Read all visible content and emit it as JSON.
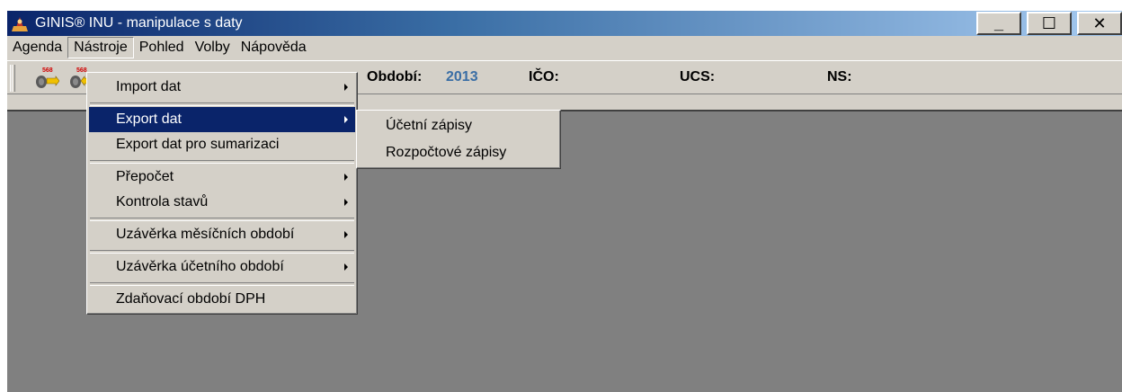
{
  "window": {
    "title": "GINIS® INU - manipulace s daty",
    "controls": {
      "minimize": "_",
      "maximize": "☐",
      "close": "✕"
    }
  },
  "menubar": [
    "Agenda",
    "Nástroje",
    "Pohled",
    "Volby",
    "Nápověda"
  ],
  "toolbar": {
    "icons": [
      "transfer-in-icon",
      "transfer-out-icon"
    ],
    "icon_label": "568",
    "obdobi_label": "Období:",
    "obdobi_value": "2013",
    "ico_label": "IČO:",
    "ucs_label": "UCS:",
    "ns_label": "NS:"
  },
  "nastroje_menu": {
    "import": "Import dat",
    "export": "Export dat",
    "export_sum": "Export dat pro sumarizaci",
    "prepocet": "Přepočet",
    "kontrola": "Kontrola stavů",
    "uzaverka_mes": "Uzávěrka měsíčních období",
    "uzaverka_uc": "Uzávěrka účetního období",
    "zdanovaci": "Zdaňovací období DPH"
  },
  "export_submenu": {
    "ucetni": "Účetní zápisy",
    "rozpoctove": "Rozpočtové zápisy"
  },
  "colors": {
    "highlight": "#0a246a",
    "title_gradient_start": "#0a246a",
    "title_gradient_end": "#a6caf0",
    "workspace": "#808080",
    "period_value": "#3a6ea5"
  }
}
